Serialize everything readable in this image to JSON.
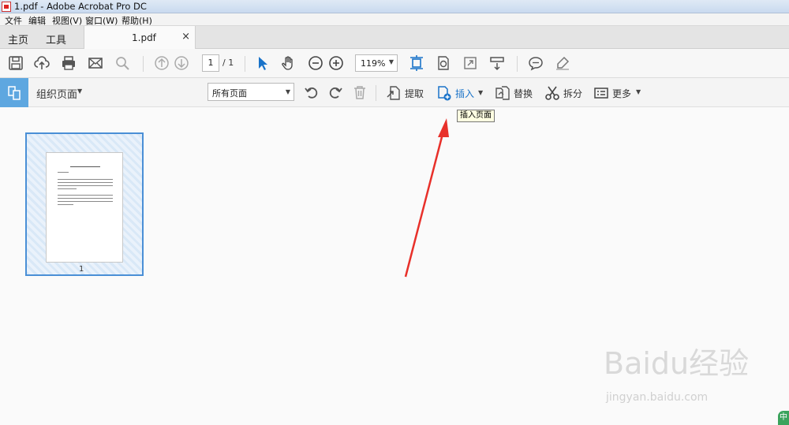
{
  "window": {
    "title": "1.pdf - Adobe Acrobat Pro DC"
  },
  "menu": {
    "items": [
      "文件",
      "编辑",
      "视图(V)",
      "窗口(W)",
      "帮助(H)"
    ]
  },
  "tabs": {
    "home": "主页",
    "tools": "工具",
    "document": "1.pdf",
    "close_glyph": "×"
  },
  "toolbar": {
    "current_page": "1",
    "total_pages": "/ 1",
    "zoom": "119%"
  },
  "organize": {
    "title": "组织页面",
    "page_filter": "所有页面",
    "extract": "提取",
    "insert": "插入",
    "replace": "替换",
    "split": "拆分",
    "more": "更多",
    "tooltip": "插入页面"
  },
  "thumbnail": {
    "page_label": "1"
  },
  "watermark": {
    "brand": "Baidu经验",
    "url": "jingyan.baidu.com",
    "badge": "中"
  },
  "colors": {
    "accent": "#1a73c9",
    "organize_icon_bg": "#5ea7e0",
    "arrow": "#e8302a",
    "selection": "#4a8fd6"
  },
  "icons": [
    "save-icon",
    "upload-icon",
    "print-icon",
    "mail-icon",
    "search-icon",
    "prev-page-icon",
    "next-page-icon",
    "select-cursor-icon",
    "hand-icon",
    "zoom-out-icon",
    "zoom-in-icon",
    "fit-page-icon",
    "rotate-ccw-icon",
    "rotate-cw-icon",
    "trash-icon",
    "extract-icon",
    "insert-icon",
    "replace-icon",
    "scissors-icon",
    "more-icon",
    "comment-icon",
    "highlight-icon"
  ]
}
